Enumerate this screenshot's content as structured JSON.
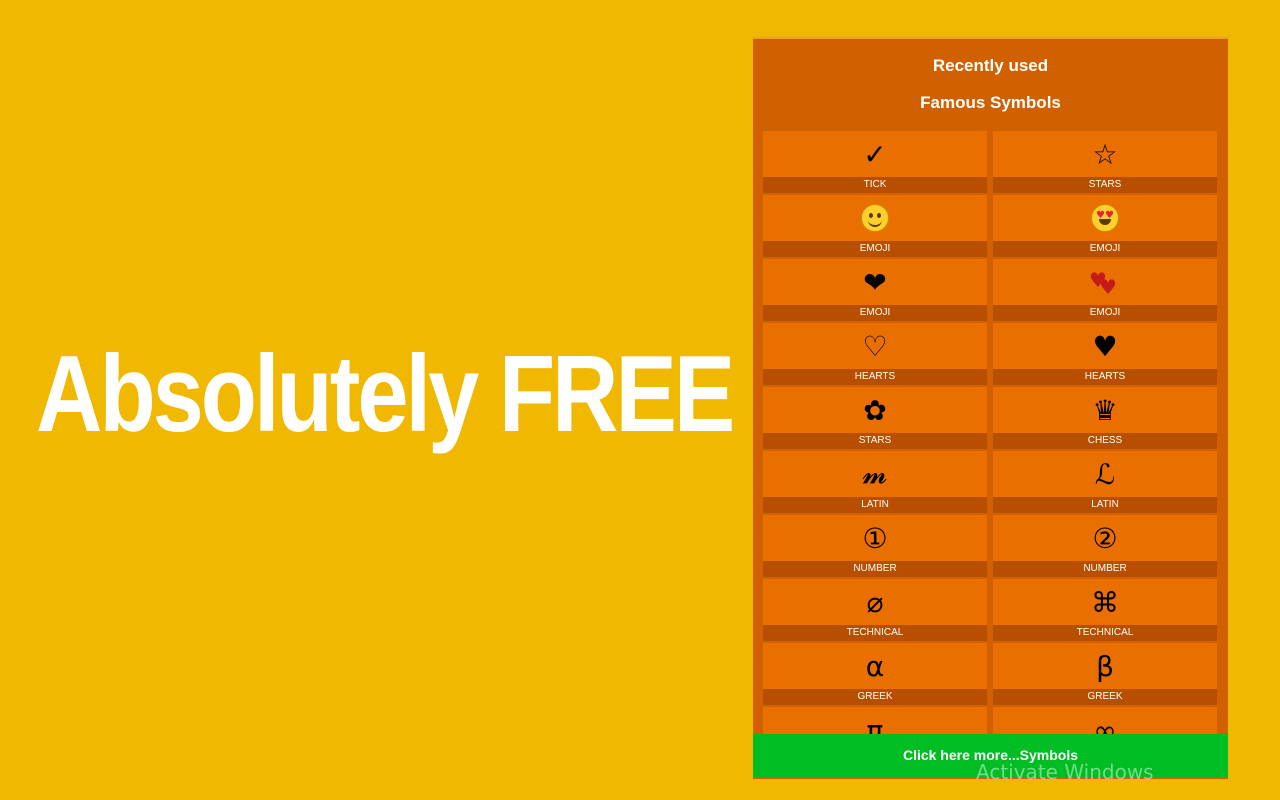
{
  "headline": "Absolutely FREE !!!",
  "popup": {
    "recent_label": "Recently used",
    "famous_label": "Famous Symbols",
    "symbols": [
      {
        "glyph": "✓",
        "label": "TICK"
      },
      {
        "glyph": "☆",
        "label": "STARS"
      },
      {
        "glyph": "😊",
        "label": "EMOJI"
      },
      {
        "glyph": "😍",
        "label": "EMOJI"
      },
      {
        "glyph": "❤",
        "label": "EMOJI"
      },
      {
        "glyph": "💕",
        "label": "EMOJI"
      },
      {
        "glyph": "♡",
        "label": "HEARTS"
      },
      {
        "glyph": "♥",
        "label": "HEARTS"
      },
      {
        "glyph": "✿",
        "label": "STARS"
      },
      {
        "glyph": "♛",
        "label": "CHESS"
      },
      {
        "glyph": "𝓶",
        "label": "LATIN"
      },
      {
        "glyph": "ℒ",
        "label": "LATIN"
      },
      {
        "glyph": "①",
        "label": "NUMBER"
      },
      {
        "glyph": "②",
        "label": "NUMBER"
      },
      {
        "glyph": "⌀",
        "label": "TECHNICAL"
      },
      {
        "glyph": "⌘",
        "label": "TECHNICAL"
      },
      {
        "glyph": "α",
        "label": "GREEK"
      },
      {
        "glyph": "β",
        "label": "GREEK"
      },
      {
        "glyph": "π",
        "label": ""
      },
      {
        "glyph": "∞",
        "label": ""
      }
    ],
    "more_button": "Click here more...Symbols"
  },
  "watermark": "Activate Windows",
  "colors": {
    "background": "#f0b800",
    "popup": "#d06000",
    "cell": "#e86f00",
    "cell_label": "#b84f00",
    "more_button": "#00bd23"
  }
}
